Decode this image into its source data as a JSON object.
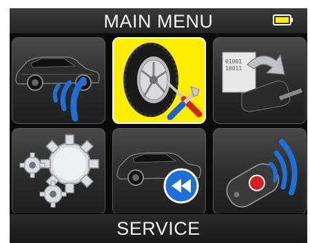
{
  "header": {
    "title": "MAIN MENU",
    "battery_icon": "battery-full-icon"
  },
  "menu": {
    "selected_index": 1,
    "items": [
      {
        "icon": "car-tpms-signal-icon"
      },
      {
        "icon": "tire-service-tools-icon"
      },
      {
        "icon": "software-update-icon"
      },
      {
        "icon": "settings-gears-icon"
      },
      {
        "icon": "car-rewind-history-icon"
      },
      {
        "icon": "remote-key-fob-signal-icon"
      }
    ]
  },
  "footer": {
    "label": "SERVICE"
  },
  "colors": {
    "selection": "#ffee00",
    "accent_blue": "#1e6fd8",
    "battery": "#ffee00"
  }
}
